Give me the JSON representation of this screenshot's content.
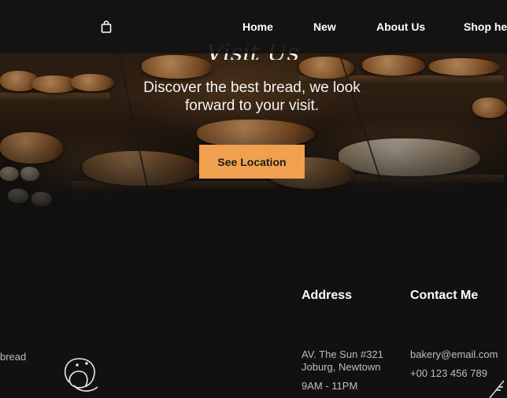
{
  "nav": {
    "links": [
      "Home",
      "New",
      "About Us",
      "Shop he"
    ]
  },
  "hero": {
    "script_title": "Visit Us",
    "tagline": "Discover the best bread, we look forward to your visit.",
    "cta_label": "See Location"
  },
  "footer": {
    "left_snippet": "bread",
    "address": {
      "heading": "Address",
      "line1": "AV. The Sun #321",
      "line2": "Joburg, Newtown",
      "hours": "9AM - 11PM"
    },
    "contact": {
      "heading": "Contact Me",
      "email": "bakery@email.com",
      "phone": "+00 123 456 789"
    }
  },
  "colors": {
    "accent": "#f0a04e",
    "background": "#111111",
    "nav_background": "#121212",
    "text_primary": "#ffffff",
    "text_secondary": "#bdbdbd"
  },
  "icons": [
    "shopping-bag-icon",
    "pretzel-illustration",
    "wheat-illustration"
  ]
}
